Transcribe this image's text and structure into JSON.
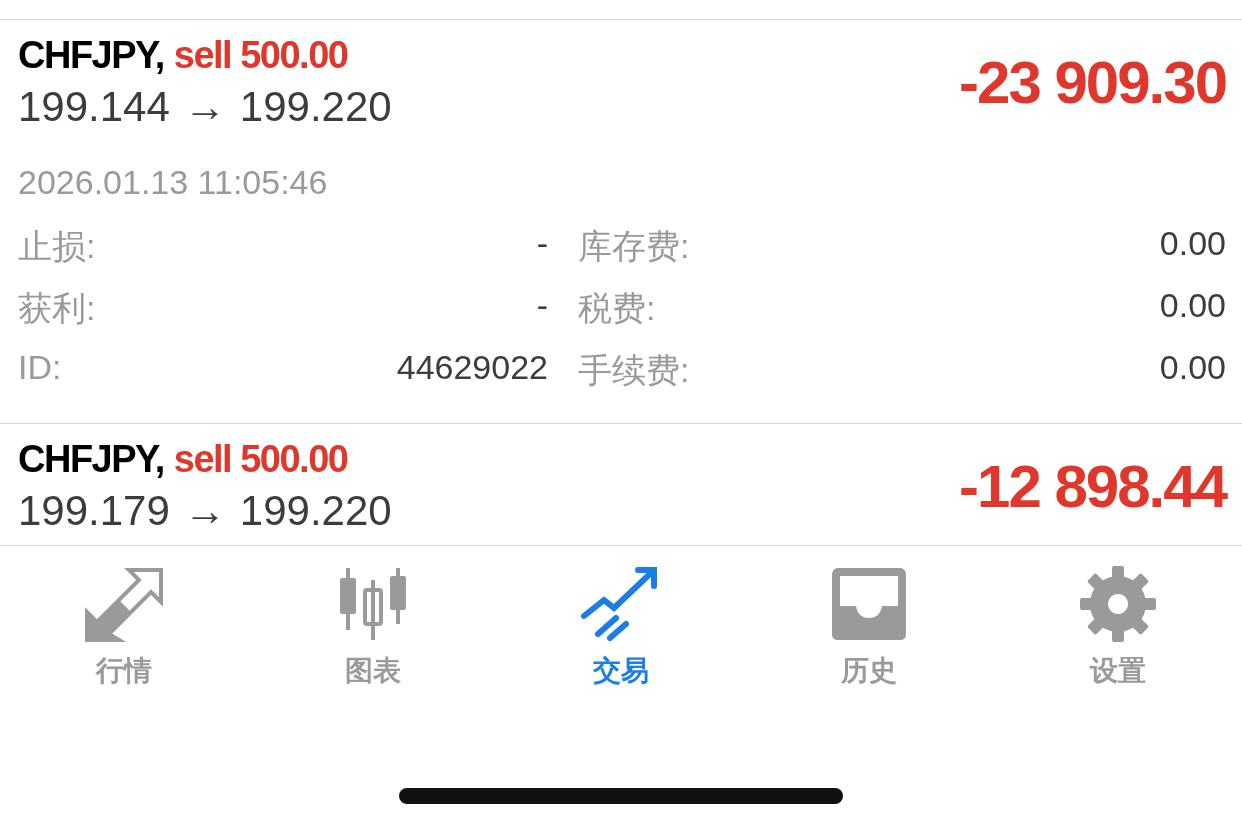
{
  "positions": [
    {
      "symbol": "CHFJPY,",
      "side": "sell 500.00",
      "open_price": "199.144",
      "arrow": "→",
      "current_price": "199.220",
      "profit": "-23 909.30",
      "expanded": true,
      "time": "2026.01.13 11:05:46",
      "details": [
        {
          "label": "止损:",
          "value": "-",
          "label_2": "库存费:",
          "value_2": "0.00"
        },
        {
          "label": "获利:",
          "value": "-",
          "label_2": "税费:",
          "value_2": "0.00"
        },
        {
          "label": "ID:",
          "value": "44629022",
          "label_2": "手续费:",
          "value_2": "0.00"
        }
      ]
    },
    {
      "symbol": "CHFJPY,",
      "side": "sell 500.00",
      "open_price": "199.179",
      "arrow": "→",
      "current_price": "199.220",
      "profit": "-12 898.44",
      "expanded": false
    }
  ],
  "tabs": [
    {
      "kind": "quotes",
      "label": "行情",
      "selected": false
    },
    {
      "kind": "chart",
      "label": "图表",
      "selected": false
    },
    {
      "kind": "trade",
      "label": "交易",
      "selected": true
    },
    {
      "kind": "history",
      "label": "历史",
      "selected": false
    },
    {
      "kind": "settings",
      "label": "设置",
      "selected": false
    }
  ]
}
